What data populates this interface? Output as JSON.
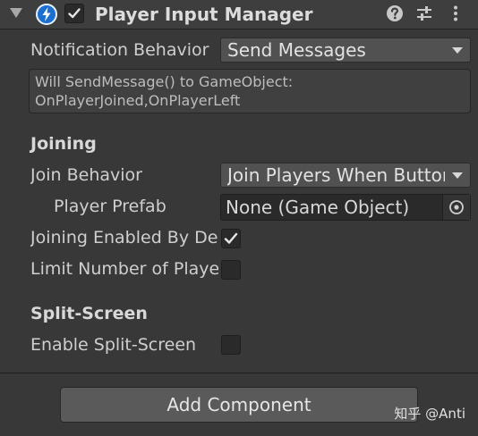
{
  "component": {
    "title": "Player Input Manager",
    "enabled": true,
    "expanded": true,
    "header_icons": [
      "help-icon",
      "presets-icon",
      "more-menu-icon"
    ]
  },
  "fields": {
    "notification_behavior": {
      "label": "Notification Behavior",
      "value": "Send Messages"
    },
    "help_text": {
      "line1": "Will SendMessage() to GameObject:",
      "line2": "OnPlayerJoined,OnPlayerLeft"
    }
  },
  "joining": {
    "heading": "Joining",
    "join_behavior": {
      "label": "Join Behavior",
      "value": "Join Players When Buttor"
    },
    "player_prefab": {
      "label": "Player Prefab",
      "value": "None (Game Object)"
    },
    "joining_enabled": {
      "label": "Joining Enabled By De",
      "checked": true
    },
    "limit_players": {
      "label": "Limit Number of Playe",
      "checked": false
    }
  },
  "split_screen": {
    "heading": "Split-Screen",
    "enable": {
      "label": "Enable Split-Screen",
      "checked": false
    }
  },
  "add_component_label": "Add Component",
  "watermark": "知乎 @Anti",
  "colors": {
    "panel_bg": "#383838",
    "header_bg": "#3e3e3e",
    "dropdown_bg": "#515151",
    "field_bg": "#2a2a2a",
    "button_bg": "#5a5a5a",
    "icon_blue": "#1b6fd1"
  }
}
